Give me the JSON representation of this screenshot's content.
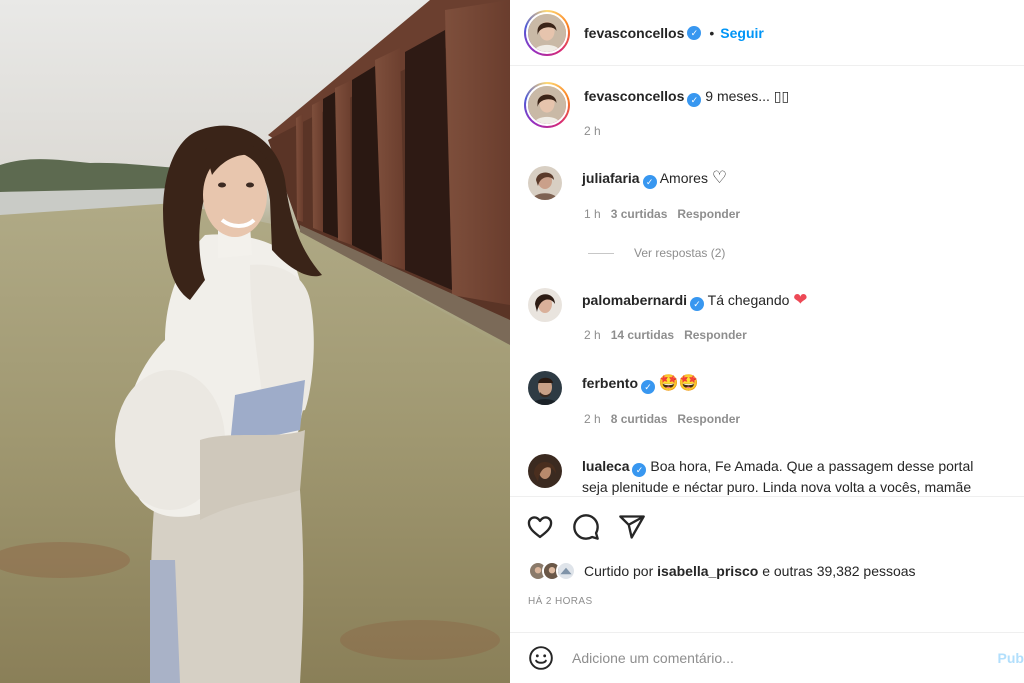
{
  "post": {
    "author": "fevasconcellos",
    "follow_label": "Seguir",
    "separator": "•"
  },
  "caption": {
    "user": "fevasconcellos",
    "text": "9 meses... ▯▯",
    "time": "2 h"
  },
  "comments": [
    {
      "user": "juliafaria",
      "text": "Amores",
      "trailing": "♡",
      "time": "1 h",
      "likes": "3 curtidas",
      "reply": "Responder"
    },
    {
      "user": "palomabernardi",
      "text": "Tá chegando",
      "trailing": "❤",
      "time": "2 h",
      "likes": "14 curtidas",
      "reply": "Responder"
    },
    {
      "user": "ferbento",
      "text": "",
      "trailing": "🤩🤩",
      "time": "2 h",
      "likes": "8 curtidas",
      "reply": "Responder"
    },
    {
      "user": "lualeca",
      "text": "Boa hora, Fe Amada. Que a passagem desse portal seja plenitude e néctar puro. Linda nova volta a vocês, mamãe",
      "trailing": "",
      "time": "",
      "likes": "",
      "reply": ""
    }
  ],
  "view_replies": "Ver respostas (2)",
  "likes": {
    "prefix": "Curtido por",
    "user": "isabella_prisco",
    "suffix": "e outras 39,382 pessoas"
  },
  "time_ago": "HÁ 2 HORAS",
  "add_comment": {
    "placeholder": "Adicione um comentário...",
    "publish": "Pub"
  },
  "colors": {
    "accent": "#0095f6",
    "verified": "#3897f0",
    "muted": "#8e8e8e",
    "heart": "#ed4956"
  },
  "icons": [
    "verified-badge-icon",
    "heart-icon",
    "comment-icon",
    "share-icon",
    "emoji-icon"
  ]
}
